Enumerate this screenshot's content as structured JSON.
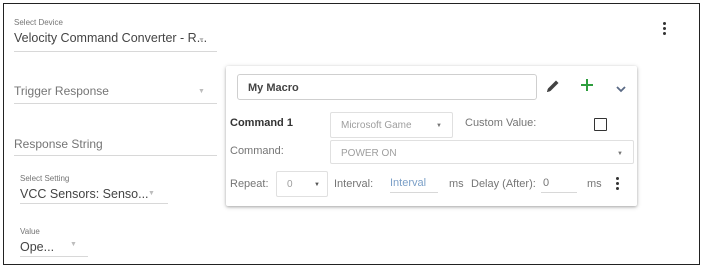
{
  "device": {
    "label": "Select Device",
    "value": "Velocity Command Converter - R..."
  },
  "trigger": {
    "label": "Trigger Response"
  },
  "response": {
    "label": "Response String"
  },
  "setting": {
    "label": "Select Setting",
    "value": "VCC Sensors: Senso..."
  },
  "value_field": {
    "label": "Value",
    "value": "Ope..."
  },
  "macro": {
    "name": "My Macro",
    "command_title": "Command 1",
    "device_select": "Microsoft Game",
    "custom_value_label": "Custom Value:",
    "command_label": "Command:",
    "command_value": "POWER ON",
    "repeat_label": "Repeat:",
    "repeat_value": "0",
    "interval_label": "Interval:",
    "interval_placeholder": "Interval",
    "interval_unit": "ms",
    "delay_label": "Delay (After):",
    "delay_value": "0",
    "delay_unit": "ms"
  },
  "colors": {
    "accent_green": "#2e9e3e",
    "icon_dark": "#424242",
    "chevron": "#5a6a85",
    "placeholder_blue": "#7b9fc7"
  }
}
